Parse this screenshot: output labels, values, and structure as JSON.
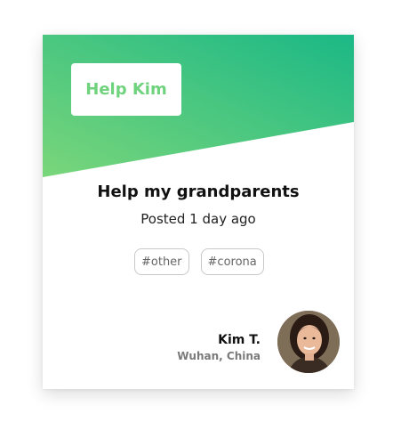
{
  "card": {
    "badge_label": "Help Kim",
    "title": "Help my grandparents",
    "posted": "Posted 1 day ago",
    "tags": [
      "#other",
      "#corona"
    ],
    "author": {
      "name": "Kim T.",
      "location": "Wuhan, China"
    }
  },
  "colors": {
    "gradient_start": "#7ad67a",
    "gradient_end": "#1bb886",
    "badge_text": "#6fd37d"
  }
}
